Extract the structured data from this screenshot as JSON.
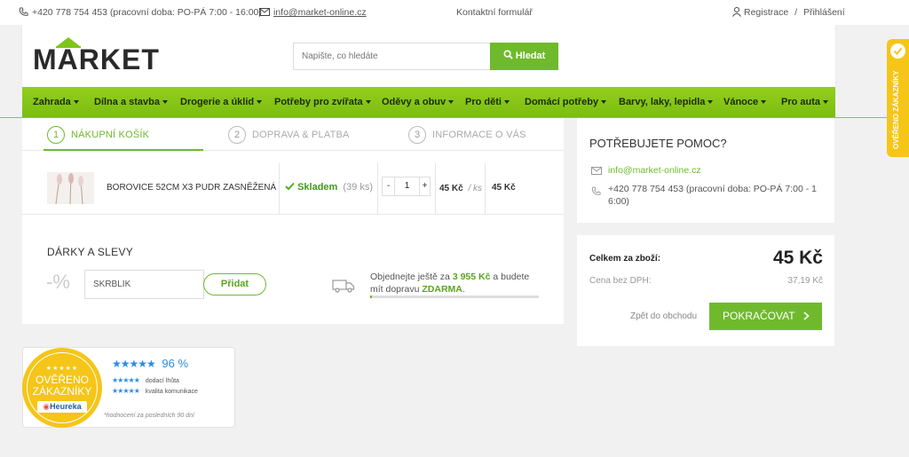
{
  "topbar": {
    "phone": "+420 778 754 453 (pracovní doba: PO-PÁ 7:00 - 16:00)",
    "email": "info@market-online.cz",
    "contact_form": "Kontaktní formulář",
    "register": "Registrace",
    "separator": "/",
    "login": "Přihlášení"
  },
  "header": {
    "logo_text": "MARKET",
    "search_placeholder": "Napište, co hledáte",
    "search_button": "Hledat"
  },
  "nav": [
    "Zahrada",
    "Dílna a stavba",
    "Drogerie a úklid",
    "Potřeby pro zvířata",
    "Oděvy a obuv",
    "Pro děti",
    "Domácí potřeby",
    "Barvy, laky, lepidla",
    "Vánoce",
    "Pro auta"
  ],
  "steps": [
    {
      "num": "1",
      "label": "NÁKUPNÍ KOŠÍK"
    },
    {
      "num": "2",
      "label": "DOPRAVA & PLATBA"
    },
    {
      "num": "3",
      "label": "INFORMACE O VÁS"
    }
  ],
  "cart_item": {
    "name": "BOROVICE 52CM X3 PUDR ZASNĚŽENÁ",
    "stock_label": "Skladem",
    "stock_count": "(39 ks)",
    "qty_minus": "-",
    "qty": "1",
    "qty_plus": "+",
    "unit_price": "45 Kč",
    "unit": "/ ks",
    "total": "45 Kč"
  },
  "discount": {
    "title": "DÁRKY A SLEVY",
    "percent_icon": "-%",
    "code_value": "SKRBLÍK",
    "add_button": "Přidat"
  },
  "shipping": {
    "text_before": "Objednejte ještě za",
    "amount": "3 955 Kč",
    "text_middle": "a budete mít dopravu",
    "free": "ZDARMA",
    "period": ".",
    "progress": 0.011
  },
  "help": {
    "title": "POTŘEBUJETE POMOC?",
    "email": "info@market-online.cz",
    "phone": "+420 778 754 453 (pracovní doba: PO-PÁ 7:00 - 1 6:00)"
  },
  "summary": {
    "total_label": "Celkem za zboží:",
    "total_value": "45 Kč",
    "novat_label": "Cena bez DPH:",
    "novat_value": "37,19 Kč",
    "back_link": "Zpět do obchodu",
    "continue_button": "POKRAČOVAT"
  },
  "heureka": {
    "badge_line1": "OVĚŘENO",
    "badge_line2": "ZÁKAZNÍKY",
    "badge_brand": "Heureka",
    "percent": "96 %",
    "row1": "dodací lhůta",
    "row2": "kvalita komunikace",
    "footnote": "*hodnocení za posledních 90 dní",
    "side_tab": "OVĚŘENO ZÁKAZNÍKY"
  },
  "colors": {
    "accent_green": "#6fba2c",
    "nav_green": "#8cc63f",
    "heureka_yellow": "#f5c518",
    "star_blue": "#2d8de0"
  }
}
